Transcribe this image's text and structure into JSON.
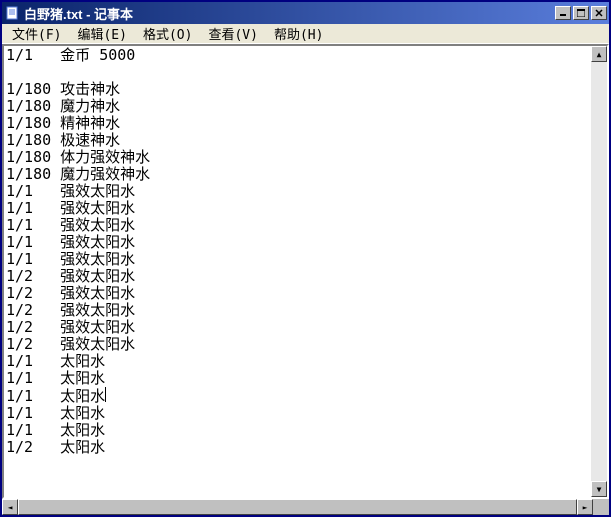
{
  "window": {
    "title": "白野猪.txt - 记事本"
  },
  "menus": {
    "file": "文件(F)",
    "edit": "编辑(E)",
    "format": "格式(O)",
    "view": "查看(V)",
    "help": "帮助(H)"
  },
  "controls": {
    "minimize": "_",
    "maximize": "□",
    "close": "✕"
  },
  "scroll": {
    "up": "▲",
    "down": "▼",
    "left": "◄",
    "right": "►"
  },
  "content": {
    "lines": [
      "1/1   金币 5000",
      "",
      "1/180 攻击神水",
      "1/180 魔力神水",
      "1/180 精神神水",
      "1/180 极速神水",
      "1/180 体力强效神水",
      "1/180 魔力强效神水",
      "1/1   强效太阳水",
      "1/1   强效太阳水",
      "1/1   强效太阳水",
      "1/1   强效太阳水",
      "1/1   强效太阳水",
      "1/2   强效太阳水",
      "1/2   强效太阳水",
      "1/2   强效太阳水",
      "1/2   强效太阳水",
      "1/2   强效太阳水",
      "1/1   太阳水",
      "1/1   太阳水",
      "1/1   太阳水",
      "1/1   太阳水",
      "1/1   太阳水",
      "1/2   太阳水"
    ],
    "cursor_line": 20,
    "cursor_col": 9
  }
}
